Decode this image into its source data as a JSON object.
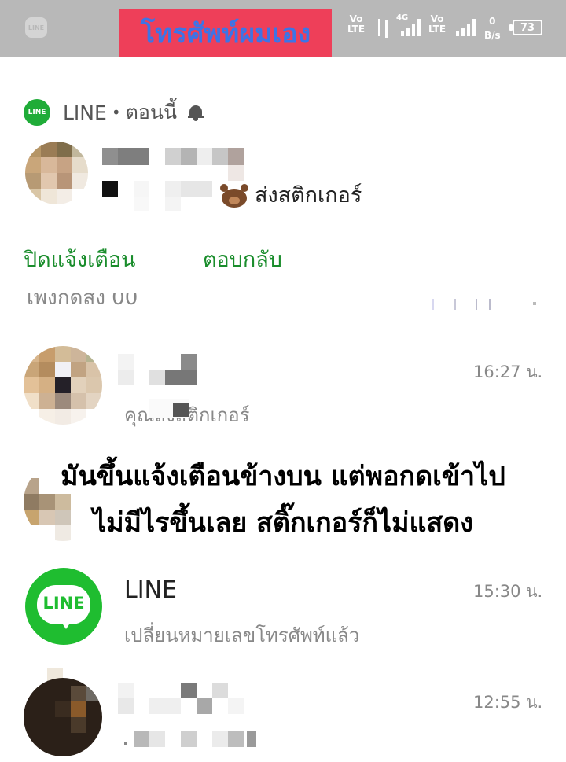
{
  "status_bar": {
    "app_icon": "line-icon",
    "app_icon_label": "LINE",
    "banner_text": "โทรศัพท์ผมเอง",
    "signal_labels": [
      "Vo\nLTE",
      "4G",
      "Vo\nLTE"
    ],
    "speed_value": "0",
    "speed_unit": "B/s",
    "battery": "73",
    "colors": {
      "bar": "#b8b8b8",
      "banner_bg": "#ee3f59",
      "banner_text": "#3d74e6"
    }
  },
  "notification": {
    "app_badge": "LINE",
    "app_name": "LINE",
    "separator": "•",
    "time": "ตอนนี้",
    "bell_icon": "bell-icon",
    "message": "ส่งสติกเกอร์",
    "actions": [
      "ปิดแจ้งเตือน",
      "ตอบกลับ"
    ],
    "accent": "#1a8d2c"
  },
  "chat_list": {
    "cut_off_text": "เพิ่งกดส่ง 00",
    "items": [
      {
        "name": "",
        "preview": "คุณส่งสติกเกอร์",
        "time": "16:27 น."
      },
      {
        "name": "",
        "preview": "",
        "time": ""
      },
      {
        "name": "LINE",
        "preview": "เปลี่ยนหมายเลขโทรศัพท์แล้ว",
        "time": "15:30 น.",
        "badge": "LINE"
      },
      {
        "name": "",
        "preview": "",
        "time": "12:55 น."
      }
    ]
  },
  "overlay": {
    "line1": "มันขึ้นแจ้งเตือนข้างบน แต่พอกดเข้าไป",
    "line2": "ไม่มีไรขึ้นเลย สติ๊กเกอร์ก็ไม่แสดง"
  }
}
